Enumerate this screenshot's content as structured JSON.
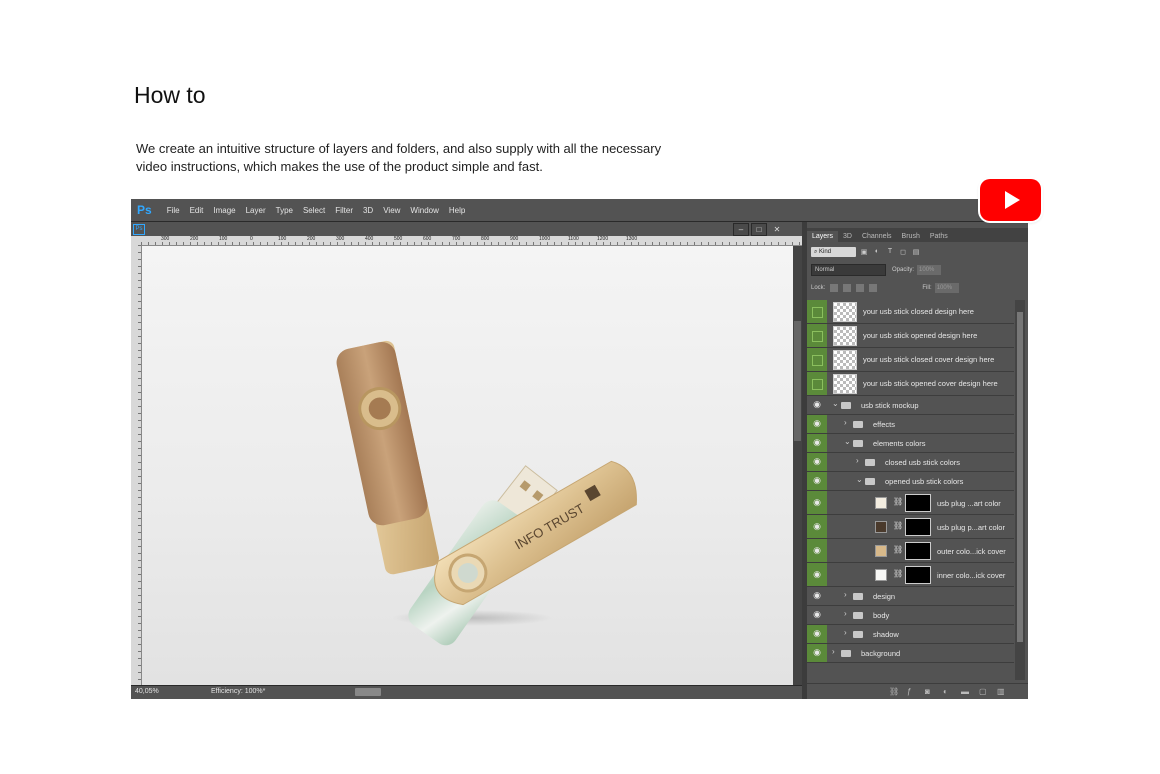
{
  "page": {
    "heading": "How to",
    "intro_lines": [
      "We create an intuitive structure of layers and folders, and also supply with all the necessary",
      "video instructions, which makes the use of the product simple and fast."
    ]
  },
  "app": {
    "logo": "Ps",
    "menu": [
      "File",
      "Edit",
      "Image",
      "Layer",
      "Type",
      "Select",
      "Filter",
      "3D",
      "View",
      "Window",
      "Help"
    ],
    "doc_icon": "Ps",
    "ruler_numbers": [
      "300",
      "200",
      "100",
      "0",
      "100",
      "200",
      "300",
      "400",
      "500",
      "600",
      "700",
      "800",
      "900",
      "1000",
      "1100",
      "1200",
      "1300"
    ]
  },
  "canvas": {
    "product_text": "INFO TRUST"
  },
  "status": {
    "zoom": "40,05%",
    "efficiency": "Efficiency: 100%*"
  },
  "panel": {
    "tabs": [
      "Layers",
      "3D",
      "Channels",
      "Brush",
      "Paths"
    ],
    "active_tab": "Layers",
    "filter_kind": "Kind",
    "blend_mode": "Normal",
    "opacity_label": "Opacity:",
    "opacity_value": "100%",
    "lock_label": "Lock:",
    "fill_label": "Fill:",
    "fill_value": "100%"
  },
  "layers": [
    {
      "name": "your usb stick closed design here",
      "type": "smart"
    },
    {
      "name": "your usb stick opened design here",
      "type": "smart"
    },
    {
      "name": "your usb stick closed cover design here",
      "type": "smart"
    },
    {
      "name": "your usb stick opened cover design here",
      "type": "smart"
    },
    {
      "name": "usb stick mockup",
      "type": "folder"
    },
    {
      "name": "effects",
      "type": "folder"
    },
    {
      "name": "elements colors",
      "type": "folder"
    },
    {
      "name": "closed usb stick colors",
      "type": "folder"
    },
    {
      "name": "opened usb stick colors",
      "type": "folder"
    },
    {
      "name": "usb plug ...art color",
      "type": "fill",
      "swatch": "#f3ede0"
    },
    {
      "name": "usb plug p...art color",
      "type": "fill",
      "swatch": "#4a3a2c"
    },
    {
      "name": "outer colo...ick cover",
      "type": "fill",
      "swatch": "#d8b98a"
    },
    {
      "name": "inner colo...ick cover",
      "type": "fill",
      "swatch": "#f7f7f5"
    },
    {
      "name": "design",
      "type": "folder"
    },
    {
      "name": "body",
      "type": "folder"
    },
    {
      "name": "shadow",
      "type": "folder"
    },
    {
      "name": "background",
      "type": "folder"
    }
  ],
  "colors": {
    "youtube_red": "#ff0000",
    "ps_blue": "#31a8ff",
    "visibility_green": "#5b8a3a"
  }
}
